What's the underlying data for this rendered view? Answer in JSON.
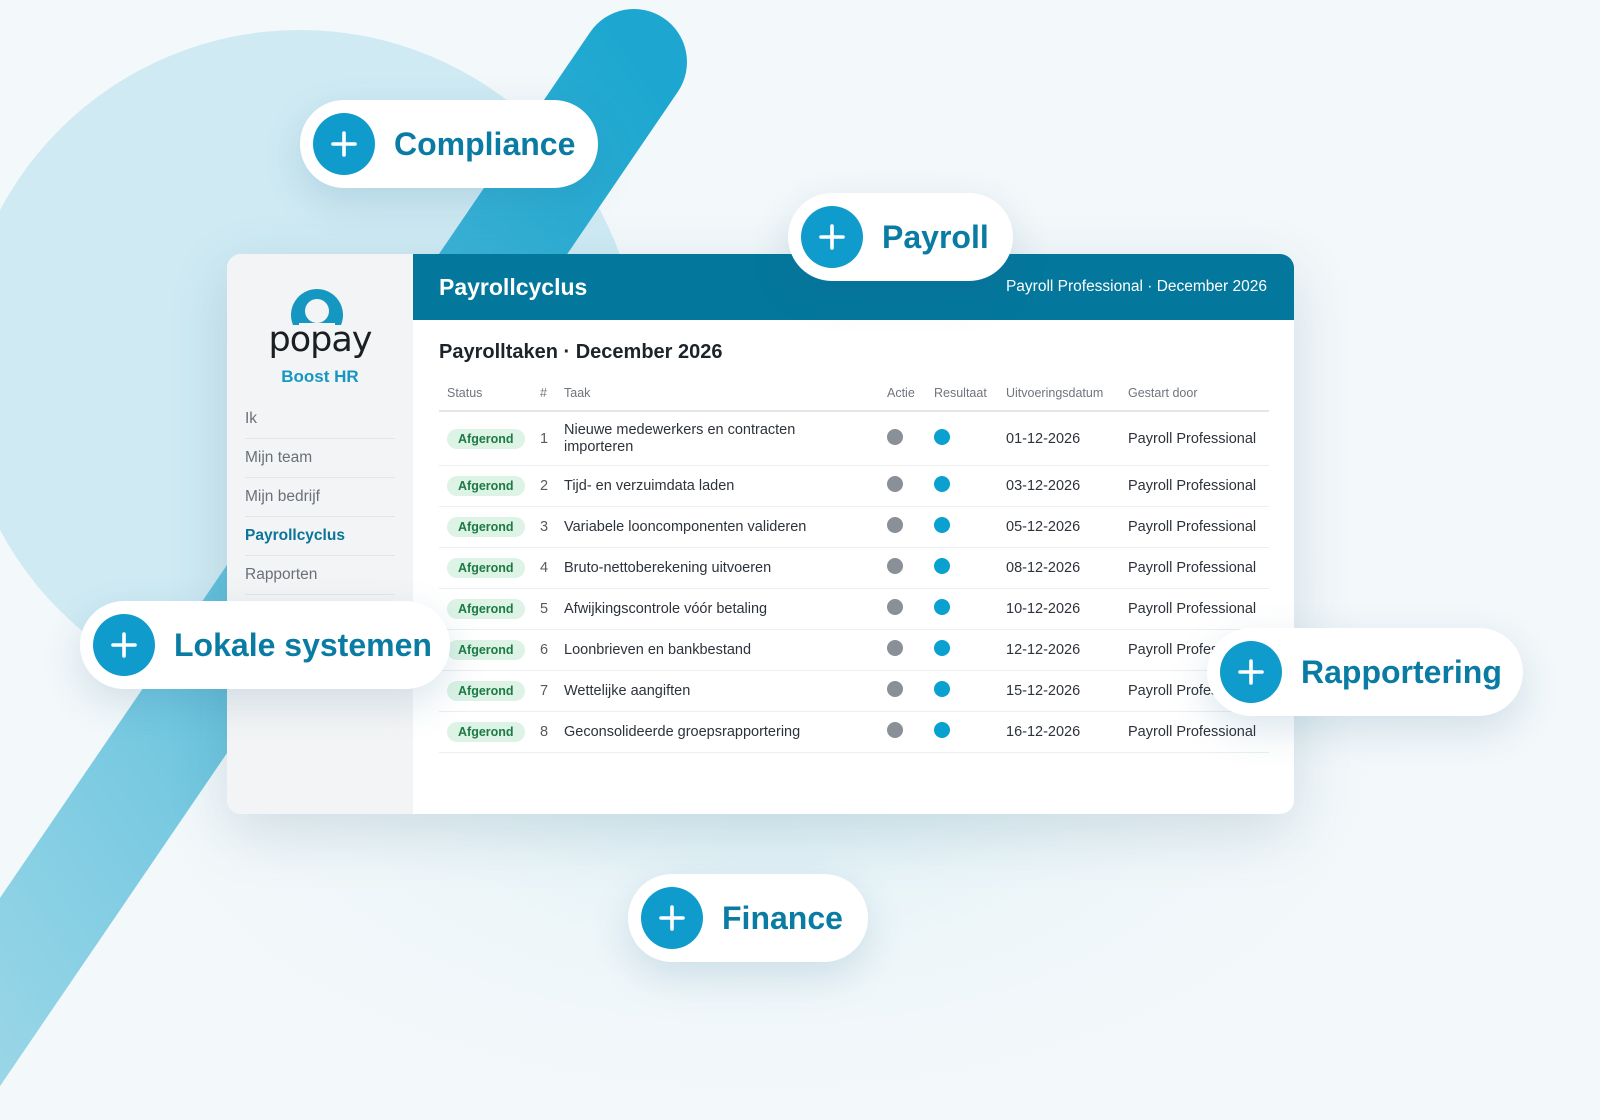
{
  "colors": {
    "accent": "#04779c",
    "accent_light": "#0f9ccd",
    "status_done_bg": "#dcf3e5",
    "status_done_text": "#1d7a44",
    "action_dot": "#8a9097",
    "result_dot": "#0aa0cf"
  },
  "modules": {
    "compliance": "Compliance",
    "payroll": "Payroll",
    "lokale_systemen": "Lokale systemen",
    "rapportering": "Rapportering",
    "finance": "Finance"
  },
  "sidebar": {
    "logo_text": "popay",
    "logo_icon": "user-icon",
    "subtitle": "Boost HR",
    "items": [
      {
        "label": "Ik",
        "active": false
      },
      {
        "label": "Mijn team",
        "active": false
      },
      {
        "label": "Mijn bedrijf",
        "active": false
      },
      {
        "label": "Payrollcyclus",
        "active": true
      },
      {
        "label": "Rapporten",
        "active": false
      }
    ]
  },
  "header": {
    "title": "Payrollcyclus",
    "meta": "Payroll Professional · December 2026"
  },
  "main": {
    "section_title": "Payrolltaken · December 2026",
    "columns": [
      "Status",
      "#",
      "Taak",
      "Actie",
      "Resultaat",
      "Uitvoeringsdatum",
      "Gestart door"
    ],
    "rows": [
      {
        "status": "Afgerond",
        "num": "1",
        "task": "Nieuwe medewerkers en contracten importeren",
        "date": "01-12-2026",
        "started_by": "Payroll Professional"
      },
      {
        "status": "Afgerond",
        "num": "2",
        "task": "Tijd- en verzuimdata laden",
        "date": "03-12-2026",
        "started_by": "Payroll Professional"
      },
      {
        "status": "Afgerond",
        "num": "3",
        "task": "Variabele looncomponenten valideren",
        "date": "05-12-2026",
        "started_by": "Payroll Professional"
      },
      {
        "status": "Afgerond",
        "num": "4",
        "task": "Bruto-nettoberekening uitvoeren",
        "date": "08-12-2026",
        "started_by": "Payroll Professional"
      },
      {
        "status": "Afgerond",
        "num": "5",
        "task": "Afwijkingscontrole vóór betaling",
        "date": "10-12-2026",
        "started_by": "Payroll Professional"
      },
      {
        "status": "Afgerond",
        "num": "6",
        "task": "Loonbrieven en bankbestand",
        "date": "12-12-2026",
        "started_by": "Payroll Professional"
      },
      {
        "status": "Afgerond",
        "num": "7",
        "task": "Wettelijke aangiften",
        "date": "15-12-2026",
        "started_by": "Payroll Professional"
      },
      {
        "status": "Afgerond",
        "num": "8",
        "task": "Geconsolideerde groepsrapportering",
        "date": "16-12-2026",
        "started_by": "Payroll Professional"
      }
    ]
  }
}
